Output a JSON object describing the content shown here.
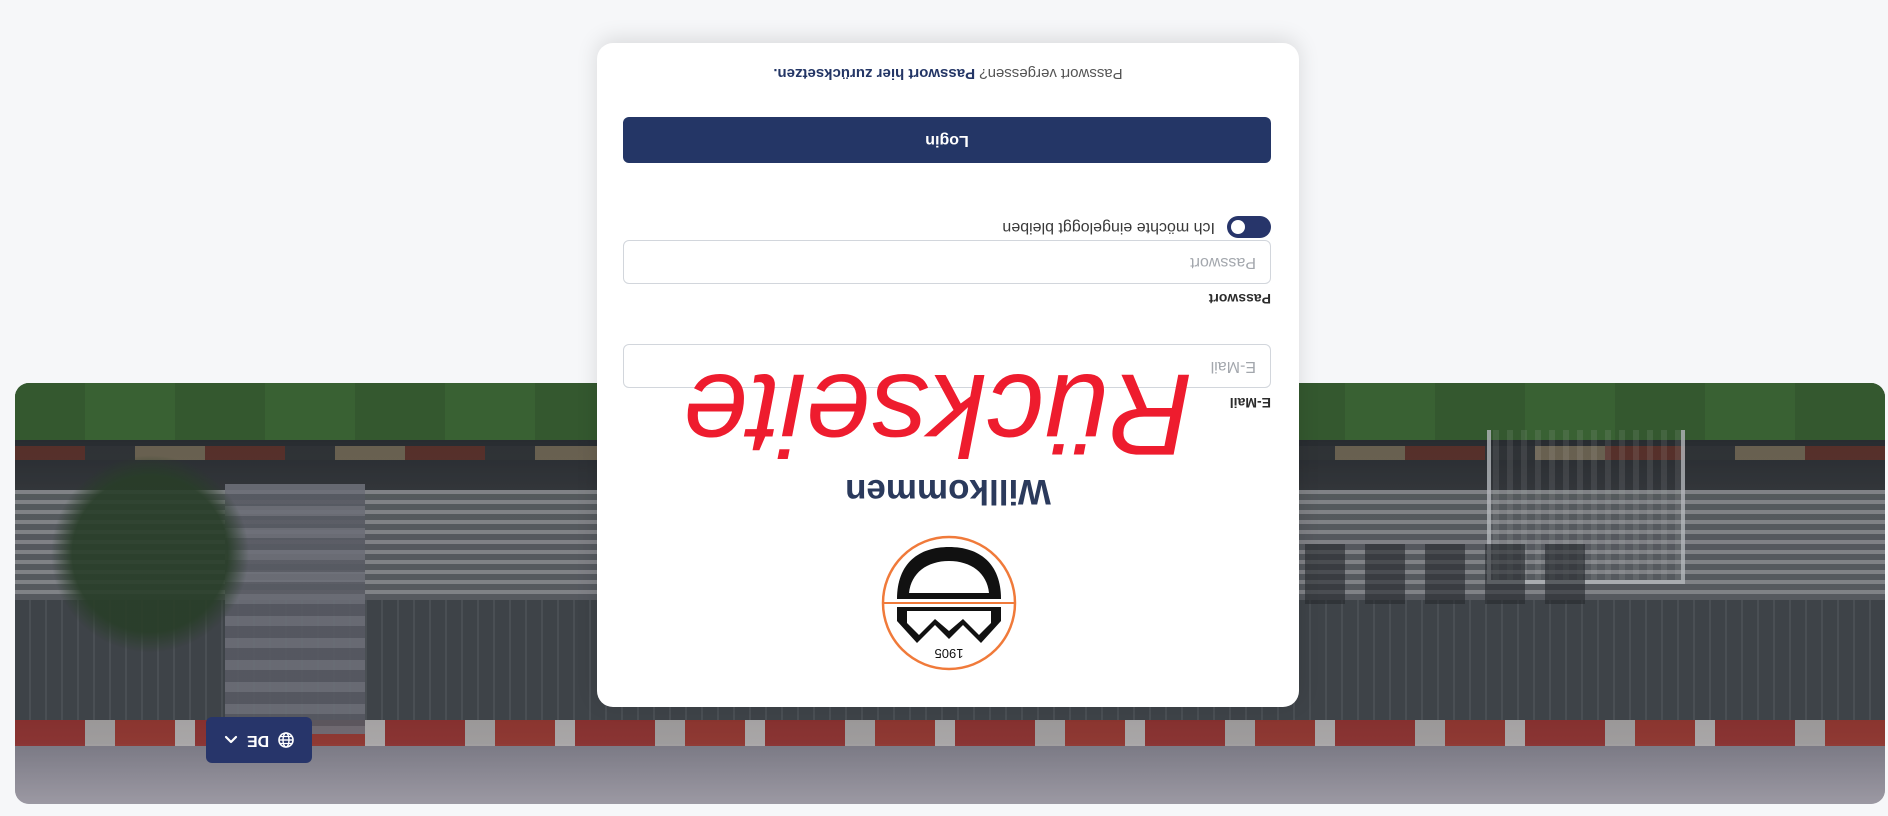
{
  "hero": {
    "language_label": "DE"
  },
  "login": {
    "logo_year": "1905",
    "title": "Willkommen",
    "email_label": "E-Mail",
    "email_placeholder": "E-Mail",
    "password_label": "Passwort",
    "password_placeholder": "Passwort",
    "remember_label": "Ich möchte eingeloggt bleiben",
    "remember_checked": true,
    "login_button": "Login",
    "forgot_text": "Passwort vergessen?",
    "forgot_link": "Passwort hier zurücksetzen."
  },
  "watermark": "Rückseite",
  "colors": {
    "primary": "#243666",
    "watermark": "#ee1c2e",
    "page_bg": "#f6f7f9",
    "logo_ring": "#f07a3a"
  },
  "icons": {
    "language": "globe-icon",
    "language_chevron": "chevron-up-icon"
  }
}
